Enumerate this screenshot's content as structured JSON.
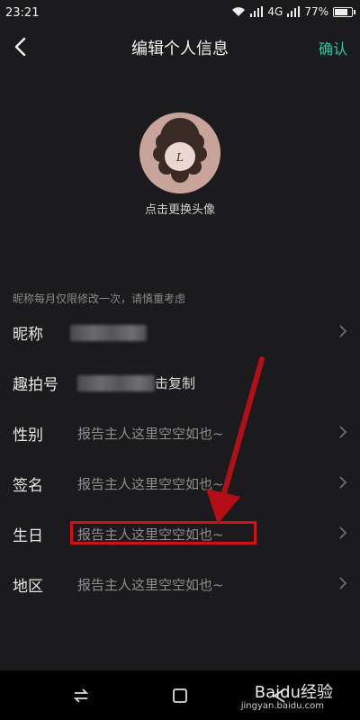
{
  "status_bar": {
    "time": "23:21",
    "network": "4G",
    "battery": "77%",
    "battery_level": 0.77
  },
  "nav": {
    "title": "编辑个人信息",
    "confirm_label": "确认",
    "accent_color": "#29c7a6"
  },
  "avatar": {
    "initial": "L",
    "hint": "点击更换头像"
  },
  "nickname_note": "昵称每月仅限修改一次，请慎重考虑",
  "rows": [
    {
      "label": "昵称",
      "value": ""
    },
    {
      "label": "趣拍号",
      "value": "击复制"
    },
    {
      "label": "性别",
      "value": "报告主人这里空空如也~"
    },
    {
      "label": "签名",
      "value": "报告主人这里空空如也~"
    },
    {
      "label": "生日",
      "value": "报告主人这里空空如也~"
    },
    {
      "label": "地区",
      "value": "报告主人这里空空如也~"
    }
  ],
  "annotation": {
    "highlight_color": "#d0111a"
  },
  "watermark": {
    "brand": "Baidu经验",
    "sub": "jingyan.baidu.com"
  }
}
